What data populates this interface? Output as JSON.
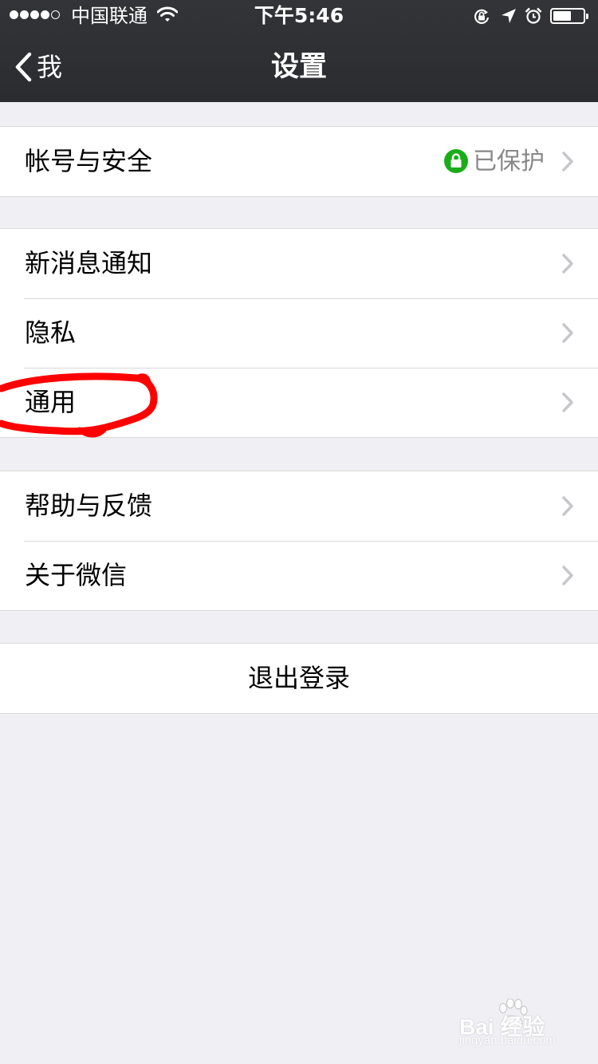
{
  "status_bar": {
    "carrier": "中国联通",
    "time": "下午5:46",
    "signal_bars_filled": 4,
    "signal_bars_total": 5,
    "battery_level": 0.6
  },
  "nav": {
    "back_label": "我",
    "title": "设置"
  },
  "groups": [
    {
      "items": [
        {
          "label": "帐号与安全",
          "value": "已保护",
          "value_icon": "lock-icon"
        }
      ]
    },
    {
      "items": [
        {
          "label": "新消息通知"
        },
        {
          "label": "隐私"
        },
        {
          "label": "通用",
          "annotated": true
        }
      ]
    },
    {
      "items": [
        {
          "label": "帮助与反馈"
        },
        {
          "label": "关于微信"
        }
      ]
    }
  ],
  "logout": {
    "label": "退出登录"
  },
  "watermark": {
    "logo": "Bai  经验",
    "url": "jingyan.baidu.com"
  },
  "colors": {
    "nav_bg": "#2e2f33",
    "background": "#efeff4",
    "accent_green": "#1aad19",
    "annotation_red": "#ff0000",
    "chevron": "#c7c7cc"
  }
}
